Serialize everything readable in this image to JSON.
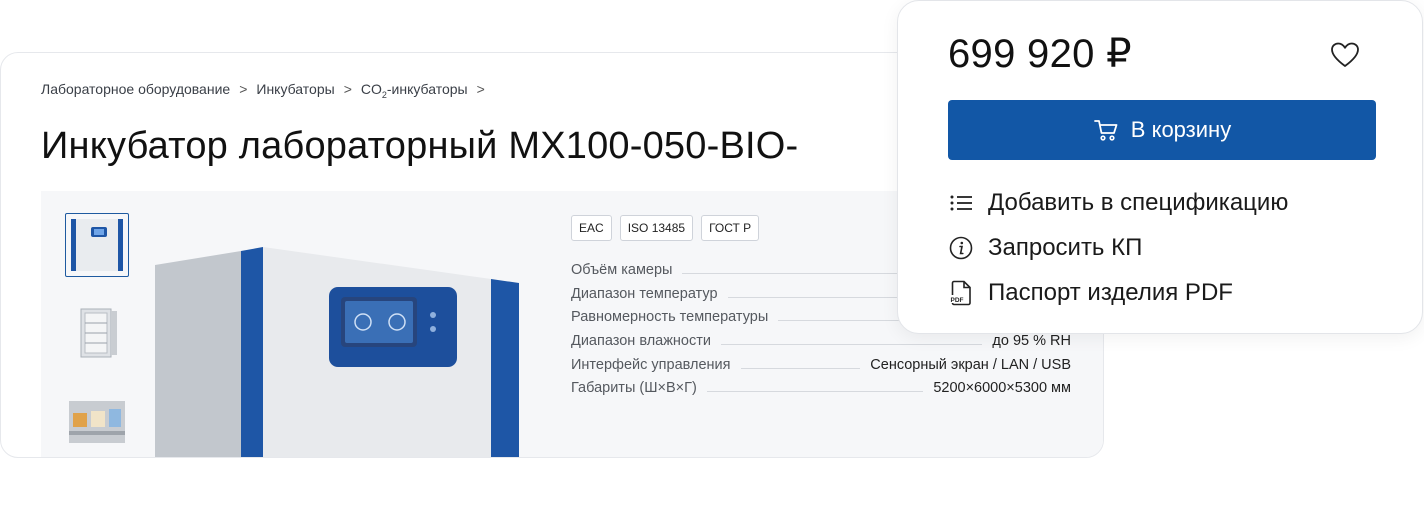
{
  "breadcrumb": {
    "items": [
      "Лабораторное оборудование",
      "Инкубаторы",
      "CO",
      "-инкубаторы"
    ],
    "co2_sub": "2",
    "separator": ">"
  },
  "product": {
    "title": "Инкубатор лабораторный MX100-050-BIO-"
  },
  "badges": [
    "EAC",
    "ISO 13485",
    "ГОСТ Р"
  ],
  "specs": [
    {
      "name": "Объём камеры",
      "value": ""
    },
    {
      "name": "Диапазон температур",
      "value": ""
    },
    {
      "name": "Равномерность температуры",
      "value": ""
    },
    {
      "name": "Диапазон влажности",
      "value": "до 95 % RH"
    },
    {
      "name": "Интерфейс управления",
      "value": "Сенсорный экран / LAN / USB"
    },
    {
      "name": "Габариты (Ш×В×Г)",
      "value": "5200×6000×5300 мм"
    }
  ],
  "buy": {
    "price": "699 920 ₽",
    "cart_label": "В корзину",
    "actions": [
      {
        "icon": "list-icon",
        "label": "Добавить в спецификацию"
      },
      {
        "icon": "info-icon",
        "label": "Запросить КП"
      },
      {
        "icon": "pdf-file-icon",
        "label": "Паспорт изделия PDF"
      }
    ]
  },
  "colors": {
    "accent": "#1257a6",
    "incubator_blue": "#1e56a6",
    "border": "#e3e5e9"
  }
}
